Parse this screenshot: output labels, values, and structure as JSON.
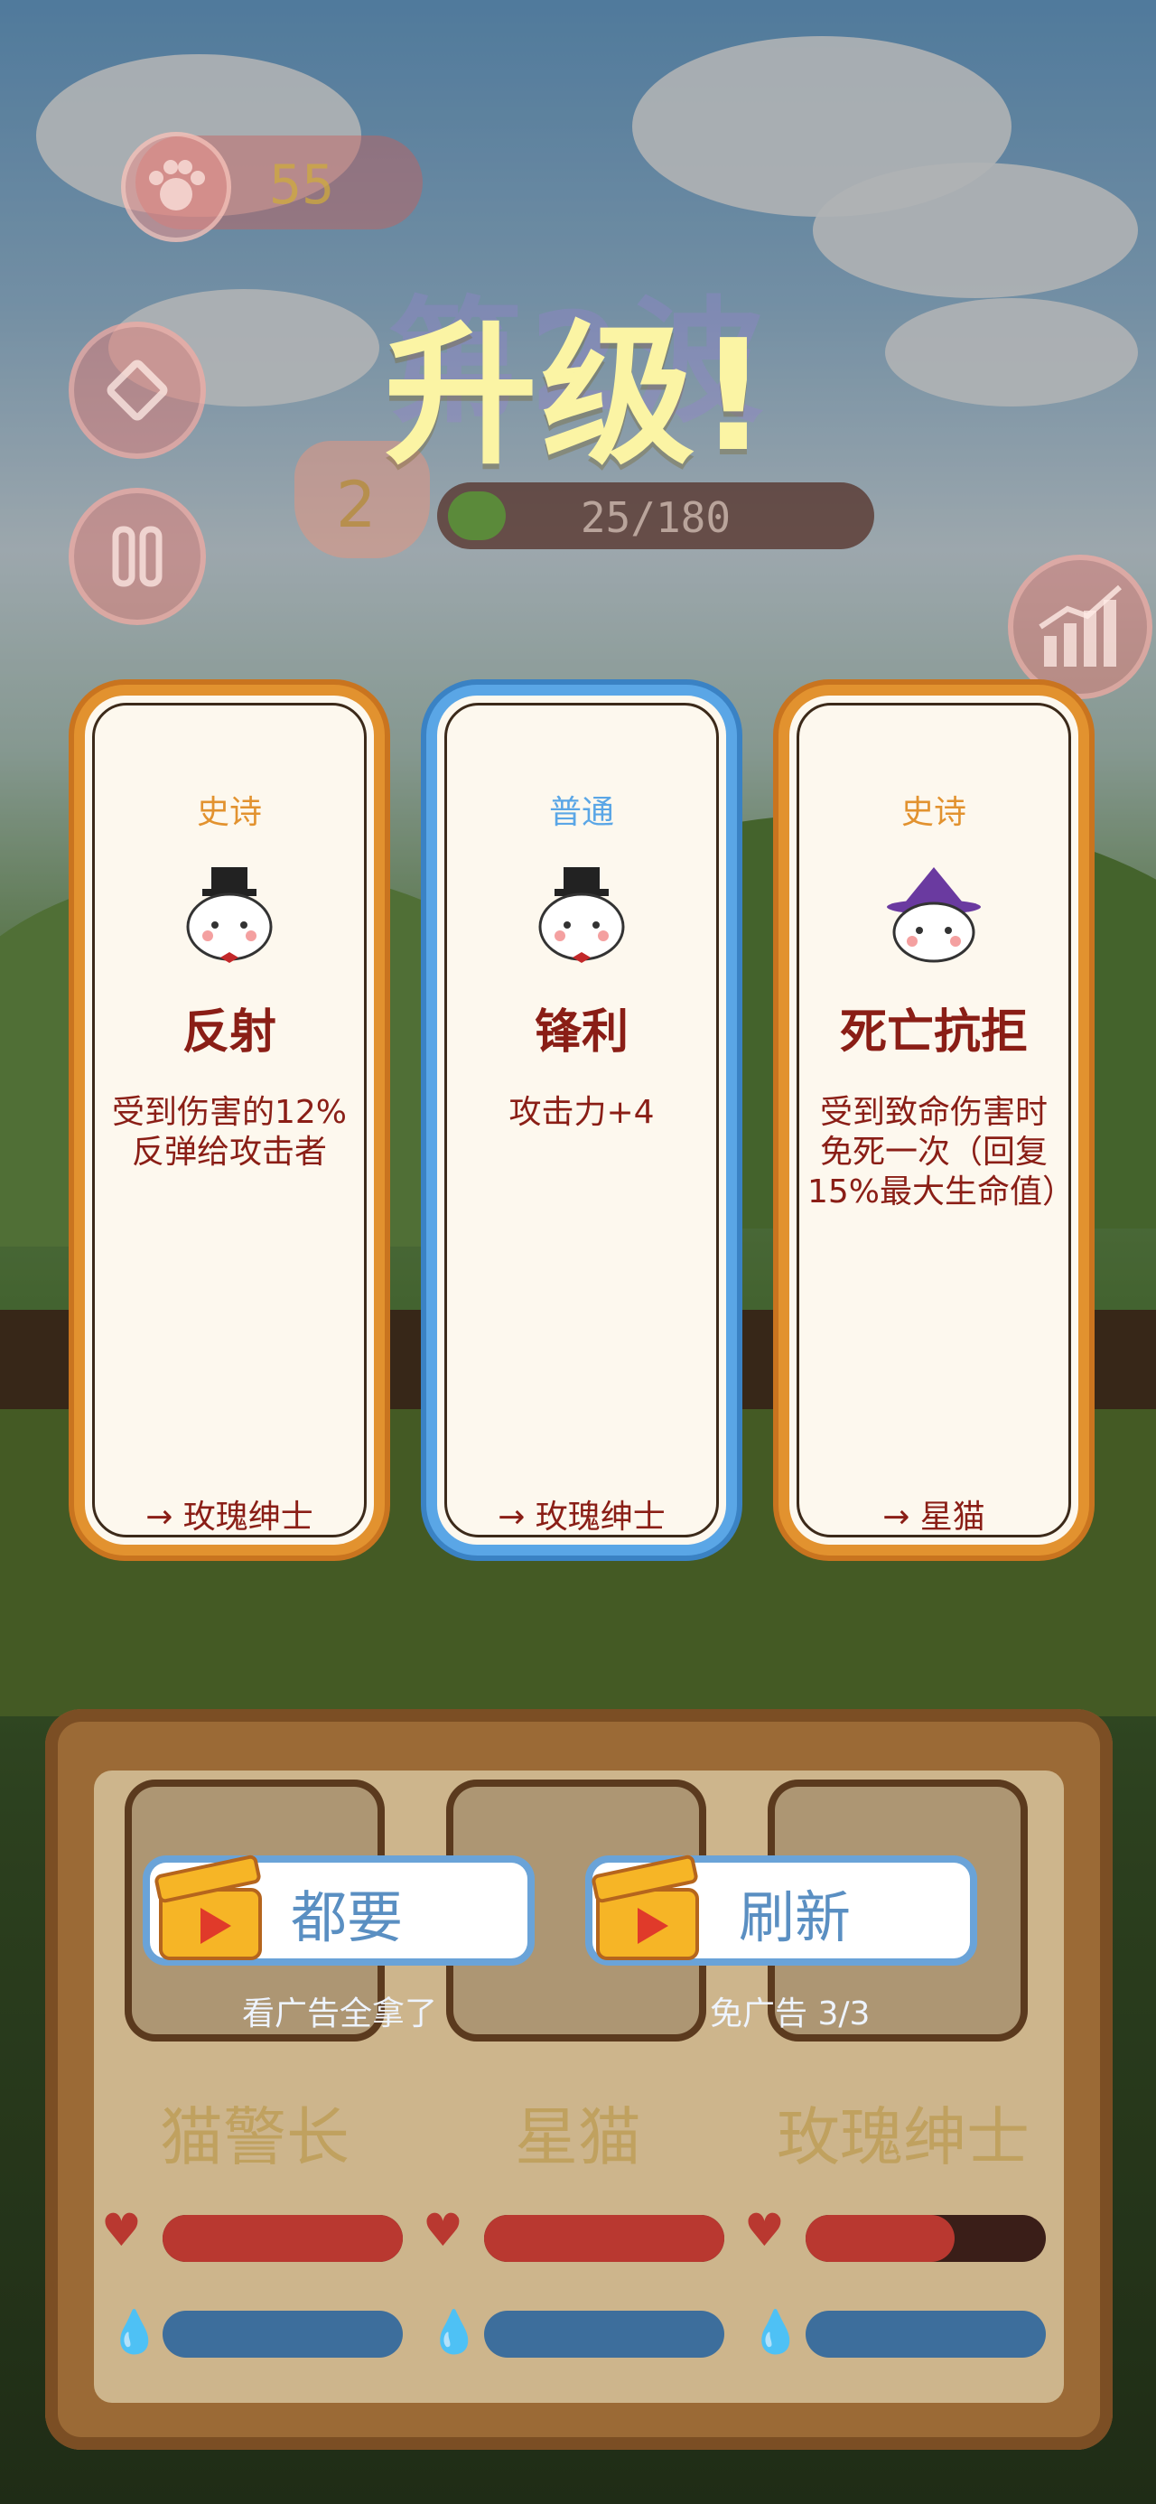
{
  "hud": {
    "coins": "55",
    "level": "2",
    "wave_title": "第2波",
    "progress_text": "25/180",
    "progress_fraction": 0.139
  },
  "overlay": {
    "title": "升级!"
  },
  "cards": [
    {
      "rarity": "史诗",
      "name": "反射",
      "desc": "受到伤害的12%反弹给攻击者",
      "target": "→ 玫瑰绅士",
      "rarity_color": "#e2922f"
    },
    {
      "rarity": "普通",
      "name": "锋利",
      "desc": "攻击力+4",
      "target": "→ 玫瑰绅士",
      "rarity_color": "#5aa6e6"
    },
    {
      "rarity": "史诗",
      "name": "死亡抗拒",
      "desc": "受到致命伤害时免死一次（回复15%最大生命值）",
      "target": "→ 星猫",
      "rarity_color": "#e2922f"
    }
  ],
  "ads": {
    "take_all_label": "都要",
    "take_all_sub": "看广告全拿了",
    "refresh_label": "刷新",
    "refresh_sub": "免广告 3/3"
  },
  "heroes": [
    {
      "name": "猫警长",
      "hp_fraction": 1.0,
      "mp_fraction": 1.0
    },
    {
      "name": "星猫",
      "hp_fraction": 1.0,
      "mp_fraction": 1.0
    },
    {
      "name": "玫瑰绅士",
      "hp_fraction": 0.62,
      "mp_fraction": 1.0
    }
  ],
  "icons": [
    "paw-coin-icon",
    "diamond-icon",
    "pause-icon",
    "stats-chart-icon",
    "heart-icon",
    "water-drop-icon",
    "clapperboard-icon",
    "cat-tophat-icon",
    "cat-wizard-icon"
  ]
}
